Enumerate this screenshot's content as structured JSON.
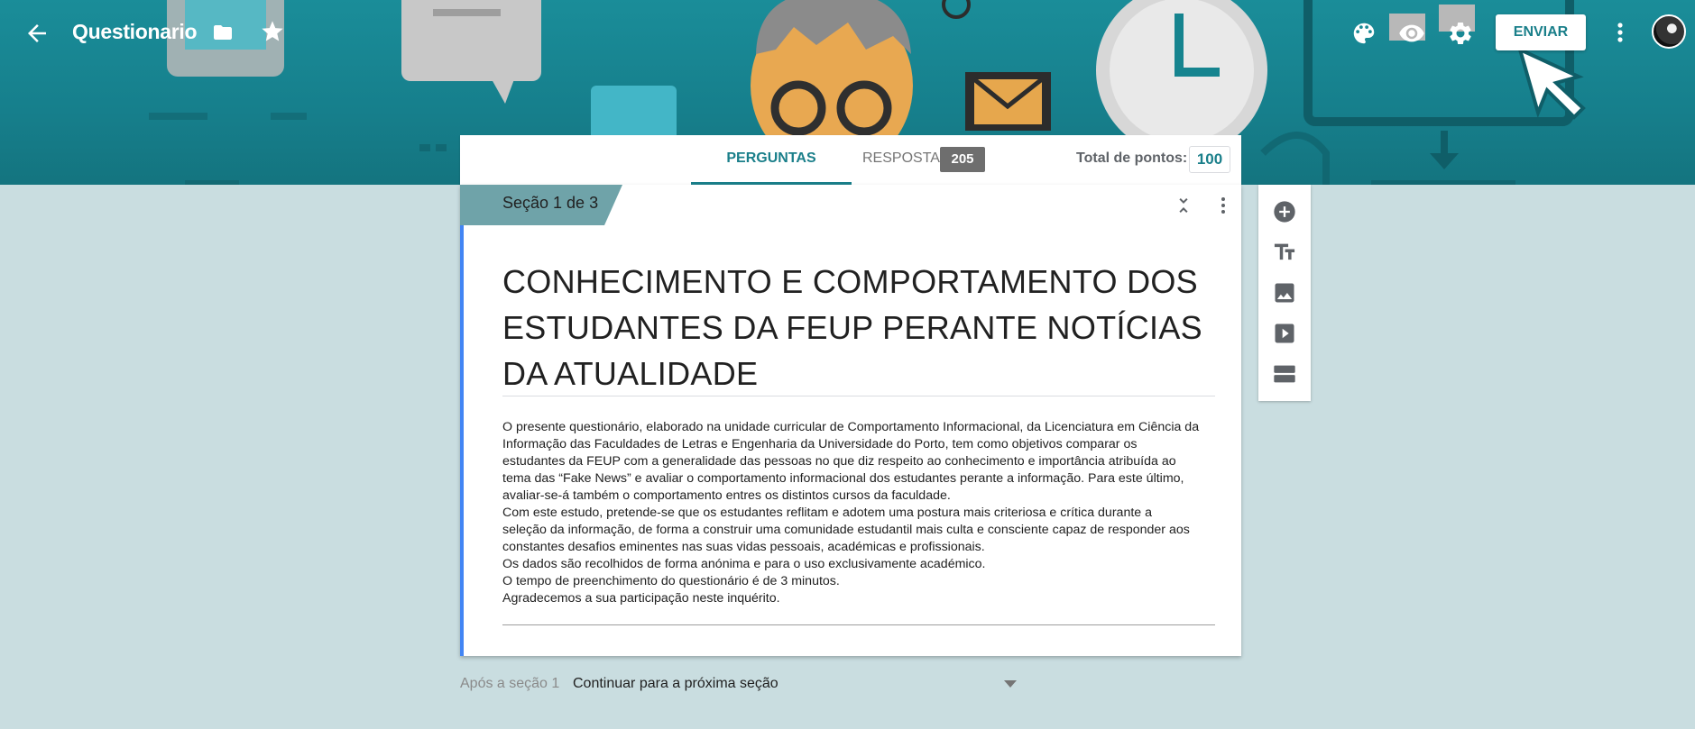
{
  "topbar": {
    "title": "Questionario",
    "send_label": "ENVIAR",
    "icons": [
      "back-arrow-icon",
      "folder-icon",
      "star-icon",
      "palette-icon",
      "eye-icon",
      "gear-icon",
      "more-vert-icon",
      "avatar"
    ]
  },
  "tabs": {
    "questions_label": "PERGUNTAS",
    "responses_label": "RESPOSTAS",
    "responses_count": "205",
    "points_label": "Total de pontos:",
    "points_value": "100"
  },
  "section": {
    "label": "Seção 1 de 3",
    "title_lines": [
      "CONHECIMENTO E COMPORTAMENTO DOS",
      "ESTUDANTES DA FEUP PERANTE NOTÍCIAS",
      "DA ATUALIDADE"
    ],
    "description": [
      "O presente questionário, elaborado na unidade curricular de Comportamento Informacional, da Licenciatura em Ciência da",
      "Informação das Faculdades de Letras e Engenharia da Universidade do Porto, tem como objetivos comparar os",
      "estudantes da FEUP com a generalidade das pessoas no que diz respeito ao conhecimento e importância atribuída ao",
      "tema das “Fake News” e avaliar o comportamento informacional dos estudantes perante a informação. Para este último,",
      "avaliar-se-á também o comportamento entres os distintos cursos da faculdade.",
      "Com este estudo, pretende-se que os estudantes reflitam e adotem uma postura mais criteriosa e crítica durante a",
      "seleção da informação, de forma a construir uma comunidade estudantil mais culta e consciente capaz de responder aos",
      "constantes desafios eminentes nas suas vidas pessoais, académicas e profissionais.",
      "Os dados são recolhidos de forma anónima e para o uso exclusivamente académico.",
      "O tempo de preenchimento do questionário é de 3 minutos.",
      "Agradecemos a sua participação neste inquérito."
    ]
  },
  "sidebar": {
    "items": [
      "add-question-icon",
      "add-title-icon",
      "add-image-icon",
      "add-video-icon",
      "add-section-icon"
    ]
  },
  "after_section": {
    "label": "Após a seção 1",
    "selected": "Continuar para a próxima seção"
  },
  "colors": {
    "banner": "#1a8d99",
    "accent": "#1a7f8a",
    "section_tab": "#6fa3a9",
    "left_bar": "#4285f4",
    "background": "#c9dde0"
  }
}
